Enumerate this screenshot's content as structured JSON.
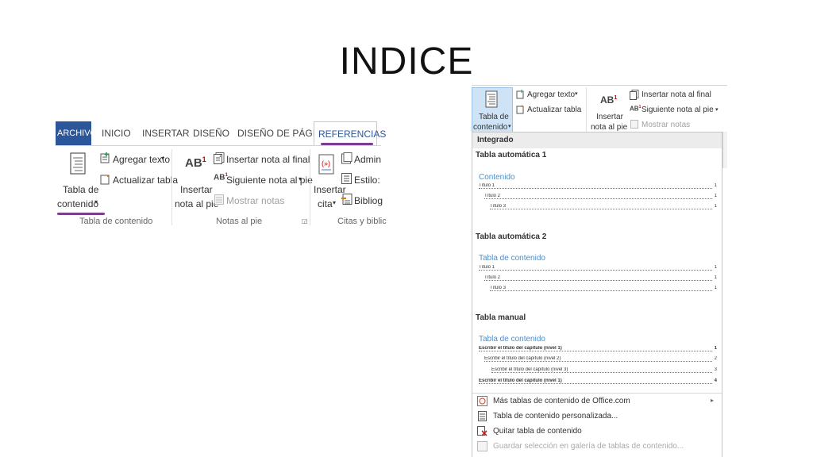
{
  "slide_title": "INDICE",
  "left_ribbon": {
    "tabs": [
      "ARCHIVO",
      "INICIO",
      "INSERTAR",
      "DISEÑO",
      "DISEÑO DE PÁGINA",
      "REFERENCIAS"
    ],
    "toc_button": [
      "Tabla de",
      "contenido"
    ],
    "add_text": "Agregar texto",
    "update_table": "Actualizar tabla",
    "group_toc": "Tabla de contenido",
    "footnote_button": [
      "Insertar",
      "nota al pie"
    ],
    "insert_endnote": "Insertar nota al final",
    "next_footnote": "Siguiente nota al pie",
    "show_notes": "Mostrar notas",
    "group_notes": "Notas al pie",
    "citation_button": [
      "Insertar",
      "cita"
    ],
    "manage": "Admin",
    "style": "Estilo:",
    "bibliography": "Bibliog",
    "group_citations": "Citas y biblic"
  },
  "right_ribbon": {
    "toc_button": [
      "Tabla de",
      "contenido"
    ],
    "add_text": "Agregar texto",
    "update_table": "Actualizar tabla",
    "footnote_button": [
      "Insertar",
      "nota al pie"
    ],
    "insert_endnote": "Insertar nota al final",
    "next_footnote": "Siguiente nota al pie",
    "show_notes": "Mostrar notas"
  },
  "dropdown": {
    "header": "Integrado",
    "auto1": {
      "label": "Tabla automática 1",
      "toc_title": "Contenido",
      "entries": [
        {
          "text": "Título 1",
          "page": "1"
        },
        {
          "text": "Título 2",
          "page": "1"
        },
        {
          "text": "Título 3",
          "page": "1"
        }
      ]
    },
    "auto2": {
      "label": "Tabla automática 2",
      "toc_title": "Tabla de contenido",
      "entries": [
        {
          "text": "Título 1",
          "page": "1"
        },
        {
          "text": "Título 2",
          "page": "1"
        },
        {
          "text": "Título 3",
          "page": "1"
        }
      ]
    },
    "manual": {
      "label": "Tabla manual",
      "toc_title": "Tabla de contenido",
      "entries": [
        {
          "text": "Escribir el título del capítulo (nivel 1)",
          "page": "1"
        },
        {
          "text": "Escribir el título del capítulo (nivel 2)",
          "page": "2"
        },
        {
          "text": "Escribir el título del capítulo (nivel 3)",
          "page": "3"
        },
        {
          "text": "Escribir el título del capítulo (nivel 1)",
          "page": "4"
        }
      ]
    },
    "menu": {
      "more_tables": "Más tablas de contenido de Office.com",
      "custom_table": "Tabla de contenido personalizada...",
      "remove_table": "Quitar tabla de contenido",
      "save_selection": "Guardar selección en galería de tablas de contenido..."
    }
  },
  "colors": {
    "accent": "#2b579a",
    "underline": "#7b3f8f",
    "toc_title": "#4a8fcf",
    "highlight": "#cfe3f6"
  }
}
